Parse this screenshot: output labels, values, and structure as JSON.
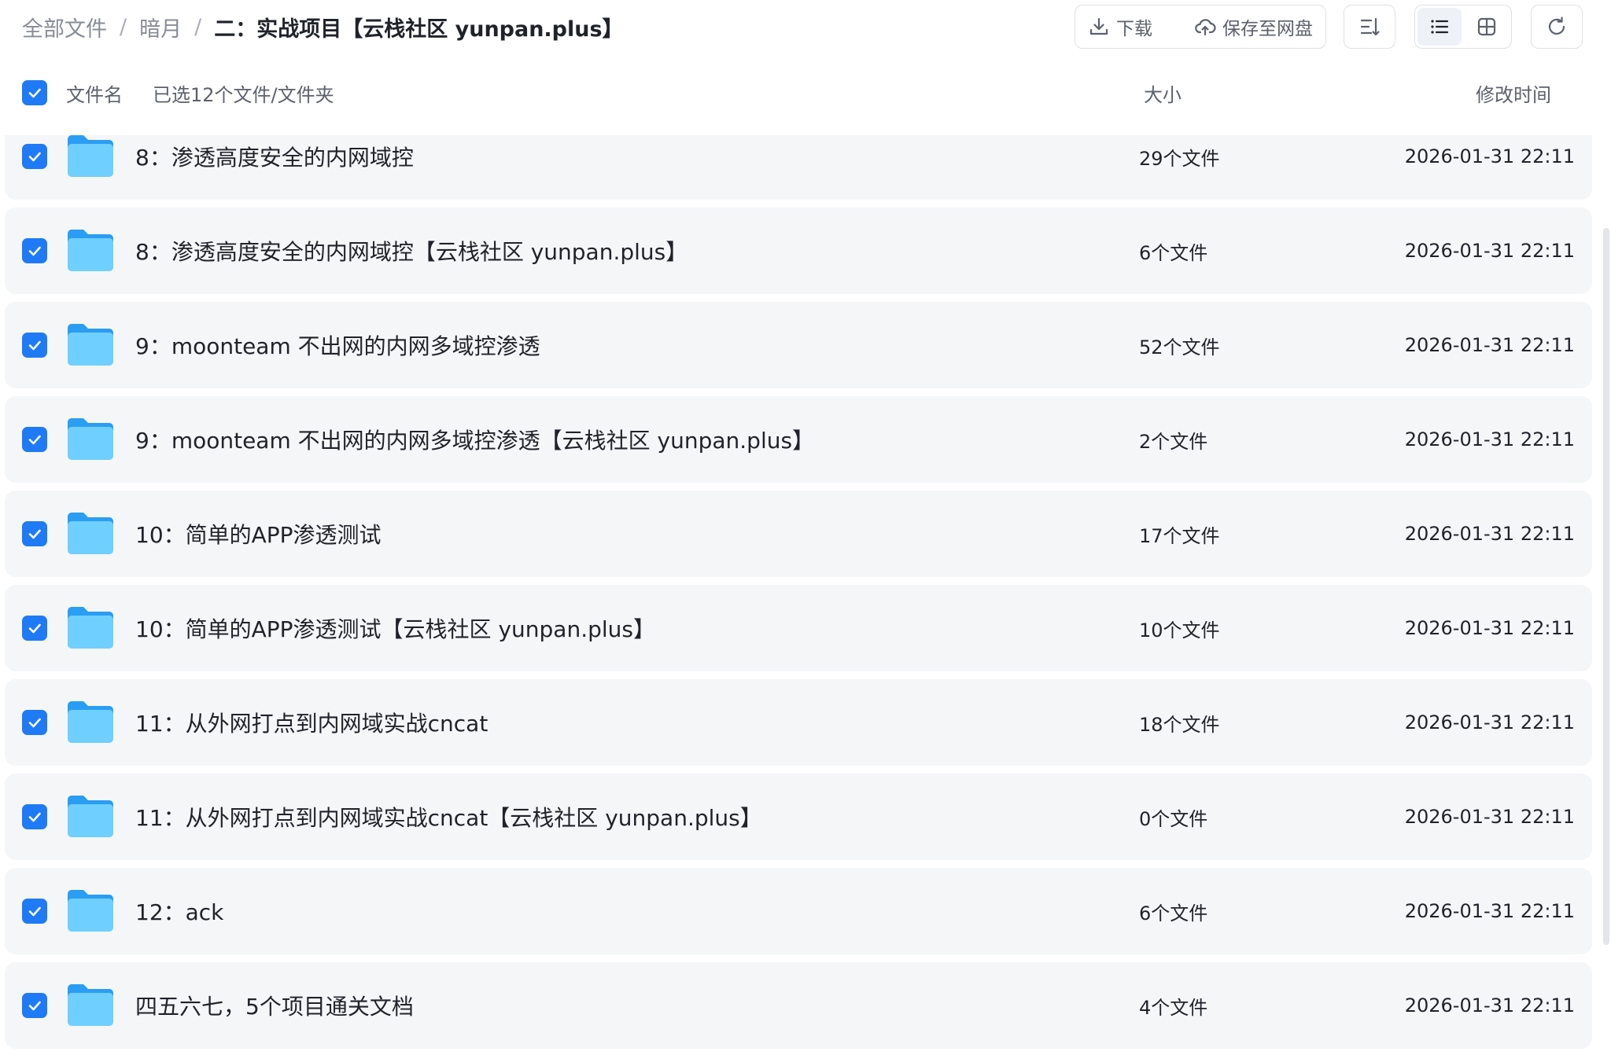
{
  "breadcrumb": {
    "items": [
      "全部文件",
      "暗月"
    ],
    "separator": "/",
    "current": "二：实战项目【云栈社区 yunpan.plus】"
  },
  "toolbar": {
    "download_label": "下载",
    "save_label": "保存至网盘"
  },
  "header": {
    "name_col": "文件名",
    "selected_text": "已选12个文件/文件夹",
    "size_col": "大小",
    "time_col": "修改时间"
  },
  "rows": [
    {
      "name": "8：渗透高度安全的内网域控",
      "size": "29个文件",
      "time": "2026-01-31 22:11"
    },
    {
      "name": "8：渗透高度安全的内网域控【云栈社区 yunpan.plus】",
      "size": "6个文件",
      "time": "2026-01-31 22:11"
    },
    {
      "name": "9：moonteam 不出网的内网多域控渗透",
      "size": "52个文件",
      "time": "2026-01-31 22:11"
    },
    {
      "name": "9：moonteam 不出网的内网多域控渗透【云栈社区 yunpan.plus】",
      "size": "2个文件",
      "time": "2026-01-31 22:11"
    },
    {
      "name": "10：简单的APP渗透测试",
      "size": "17个文件",
      "time": "2026-01-31 22:11"
    },
    {
      "name": "10：简单的APP渗透测试【云栈社区 yunpan.plus】",
      "size": "10个文件",
      "time": "2026-01-31 22:11"
    },
    {
      "name": "11：从外网打点到内网域实战cncat",
      "size": "18个文件",
      "time": "2026-01-31 22:11"
    },
    {
      "name": "11：从外网打点到内网域实战cncat【云栈社区 yunpan.plus】",
      "size": "0个文件",
      "time": "2026-01-31 22:11"
    },
    {
      "name": "12：ack",
      "size": "6个文件",
      "time": "2026-01-31 22:11"
    },
    {
      "name": "四五六七，5个项目通关文档",
      "size": "4个文件",
      "time": "2026-01-31 22:11"
    }
  ],
  "colors": {
    "accent": "#1f7af5",
    "row_bg": "#f5f6f8",
    "folder_light": "#6fcfff",
    "folder_dark": "#2a9df4"
  },
  "icons": [
    "download-icon",
    "cloud-upload-icon",
    "sort-icon",
    "list-view-icon",
    "grid-view-icon",
    "refresh-icon",
    "folder-icon",
    "checkbox-checked-icon"
  ]
}
